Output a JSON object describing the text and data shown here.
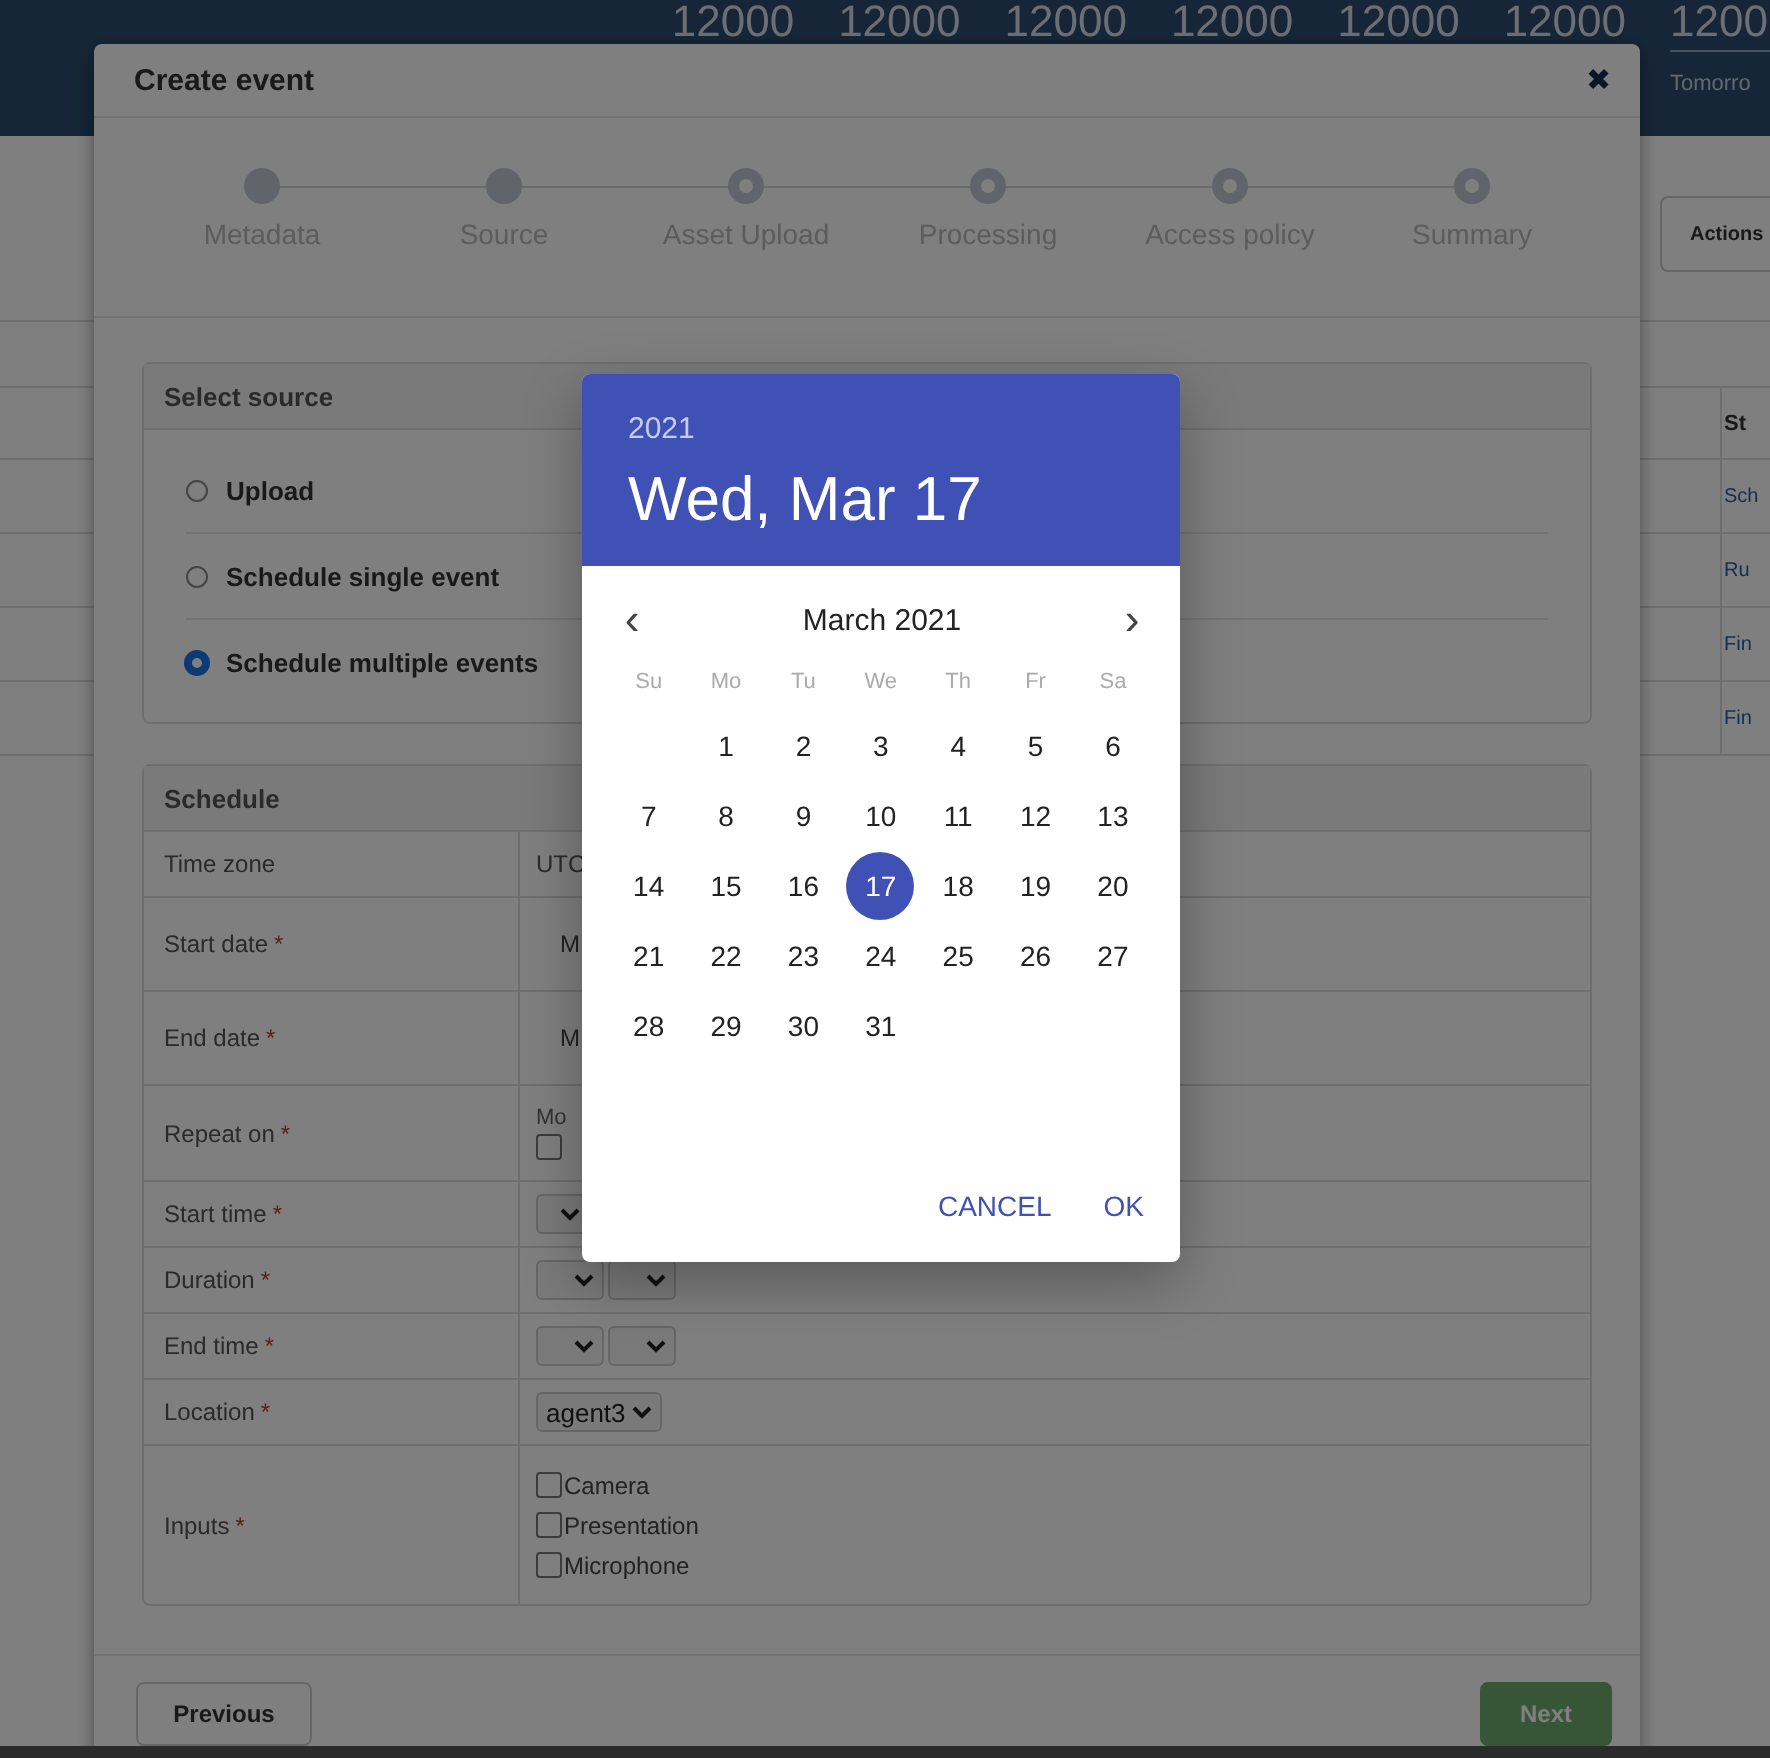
{
  "background": {
    "header_numbers": [
      "12000",
      "12000",
      "12000",
      "12000",
      "12000",
      "12000"
    ],
    "header_side": {
      "number": "1200",
      "caption": "Tomorro"
    },
    "actions_button": "Actions",
    "table": {
      "header": "St",
      "rows": [
        "Sch",
        "Ru",
        "Fin",
        "Fin"
      ]
    }
  },
  "modal": {
    "title": "Create event",
    "close": "✖",
    "steps": [
      {
        "label": "Metadata",
        "done": true
      },
      {
        "label": "Source",
        "done": true
      },
      {
        "label": "Asset Upload",
        "done": false
      },
      {
        "label": "Processing",
        "done": false
      },
      {
        "label": "Access policy",
        "done": false
      },
      {
        "label": "Summary",
        "done": false
      }
    ],
    "source_panel": {
      "title": "Select source",
      "options": [
        {
          "label": "Upload",
          "selected": false
        },
        {
          "label": "Schedule single event",
          "selected": false
        },
        {
          "label": "Schedule multiple events",
          "selected": true
        }
      ]
    },
    "schedule_panel": {
      "title": "Schedule",
      "rows": [
        {
          "label": "Time zone",
          "kind": "text",
          "value": "UTC"
        },
        {
          "label": "Start date",
          "mark": "*",
          "kind": "date",
          "value": "M"
        },
        {
          "label": "End date",
          "mark": "*",
          "kind": "date",
          "value": "M"
        },
        {
          "label": "Repeat on",
          "mark": "*",
          "kind": "days",
          "days": [
            {
              "label": "Mo",
              "checked": false
            }
          ]
        },
        {
          "label": "Start time",
          "mark": "*",
          "kind": "select-single"
        },
        {
          "label": "Duration",
          "mark": "*",
          "kind": "select-pair"
        },
        {
          "label": "End time",
          "mark": "*",
          "kind": "select-pair"
        },
        {
          "label": "Location",
          "mark": "*",
          "kind": "select",
          "value": "agent3"
        },
        {
          "label": "Inputs",
          "mark": "*",
          "kind": "checks",
          "options": [
            {
              "label": "Camera",
              "checked": false
            },
            {
              "label": "Presentation",
              "checked": false
            },
            {
              "label": "Microphone",
              "checked": false
            }
          ]
        }
      ]
    },
    "previous_button": "Previous",
    "next_button": {
      "label": "Next",
      "disabled": true
    }
  },
  "date_picker": {
    "year": "2021",
    "date": "Wed, Mar 17",
    "month": "March 2021",
    "prev": "‹",
    "next": "›",
    "weekdays": [
      "Su",
      "Mo",
      "Tu",
      "We",
      "Th",
      "Fr",
      "Sa"
    ],
    "weeks": [
      [
        {
          "label": "1",
          "selected": false
        },
        {
          "label": "2",
          "selected": false
        },
        {
          "label": "3",
          "selected": false
        },
        {
          "label": "4",
          "selected": false
        },
        {
          "label": "5",
          "selected": false
        },
        {
          "label": "6",
          "selected": false
        }
      ],
      [
        {
          "label": "7",
          "selected": false
        },
        {
          "label": "8",
          "selected": false
        },
        {
          "label": "9",
          "selected": false
        },
        {
          "label": "10",
          "selected": false
        },
        {
          "label": "11",
          "selected": false
        },
        {
          "label": "12",
          "selected": false
        },
        {
          "label": "13",
          "selected": false
        }
      ],
      [
        {
          "label": "14",
          "selected": false
        },
        {
          "label": "15",
          "selected": false
        },
        {
          "label": "16",
          "selected": false
        },
        {
          "label": "17",
          "selected": true
        },
        {
          "label": "18",
          "selected": false
        },
        {
          "label": "19",
          "selected": false
        },
        {
          "label": "20",
          "selected": false
        }
      ],
      [
        {
          "label": "21",
          "selected": false
        },
        {
          "label": "22",
          "selected": false
        },
        {
          "label": "23",
          "selected": false
        },
        {
          "label": "24",
          "selected": false
        },
        {
          "label": "25",
          "selected": false
        },
        {
          "label": "26",
          "selected": false
        },
        {
          "label": "27",
          "selected": false
        }
      ],
      [
        {
          "label": "28",
          "selected": false
        },
        {
          "label": "29",
          "selected": false
        },
        {
          "label": "30",
          "selected": false
        },
        {
          "label": "31",
          "selected": false
        }
      ]
    ],
    "buttons": [
      "CANCEL",
      "OK"
    ]
  }
}
